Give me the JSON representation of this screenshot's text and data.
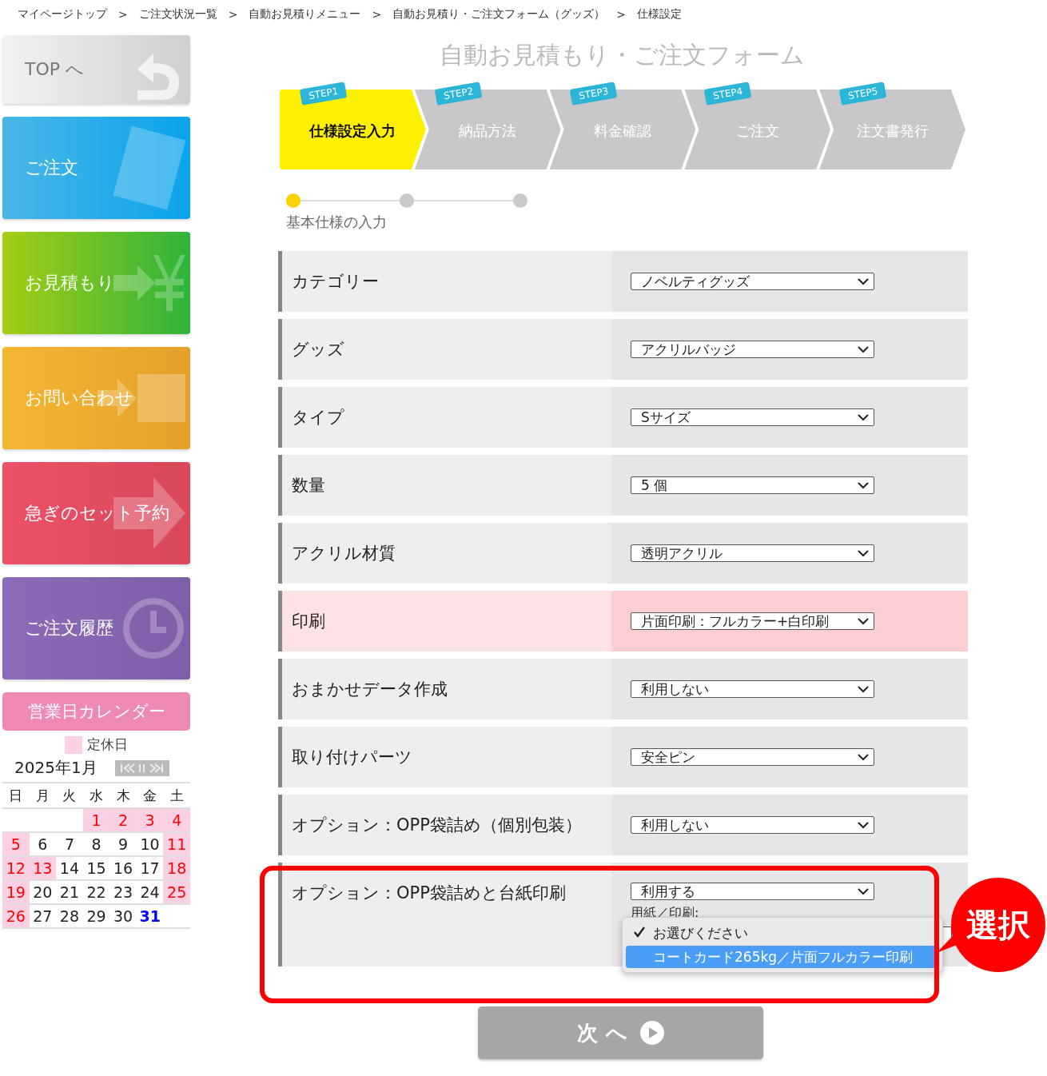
{
  "breadcrumb": [
    "マイページトップ",
    "ご注文状況一覧",
    "自動お見積りメニュー",
    "自動お見積り・ご注文フォーム（グッズ）",
    "仕様設定"
  ],
  "breadcrumb_separator": ">",
  "sidebar": {
    "nav": [
      {
        "label": "TOP へ",
        "kind": "top"
      },
      {
        "label": "ご注文",
        "kind": "order"
      },
      {
        "label": "お見積もり",
        "kind": "estimate"
      },
      {
        "label": "お問い合わせ",
        "kind": "contact"
      },
      {
        "label": "急ぎのセット予約",
        "kind": "rush"
      },
      {
        "label": "ご注文履歴",
        "kind": "history"
      }
    ],
    "calendar": {
      "button": "営業日カレンダー",
      "legend": "定休日",
      "month": "2025年1月",
      "weekdays": [
        "日",
        "月",
        "火",
        "水",
        "木",
        "金",
        "土"
      ],
      "weeks": [
        [
          {
            "kind": "blank"
          },
          {
            "kind": "blank"
          },
          {
            "kind": "blank"
          },
          {
            "day": "1",
            "kind": "holiday"
          },
          {
            "day": "2",
            "kind": "holiday"
          },
          {
            "day": "3",
            "kind": "holiday"
          },
          {
            "day": "4",
            "kind": "holiday"
          }
        ],
        [
          {
            "day": "5",
            "kind": "holiday"
          },
          {
            "day": "6",
            "kind": "normal"
          },
          {
            "day": "7",
            "kind": "normal"
          },
          {
            "day": "8",
            "kind": "normal"
          },
          {
            "day": "9",
            "kind": "normal"
          },
          {
            "day": "10",
            "kind": "normal"
          },
          {
            "day": "11",
            "kind": "holiday"
          }
        ],
        [
          {
            "day": "12",
            "kind": "holiday"
          },
          {
            "day": "13",
            "kind": "holiday"
          },
          {
            "day": "14",
            "kind": "normal"
          },
          {
            "day": "15",
            "kind": "normal"
          },
          {
            "day": "16",
            "kind": "normal"
          },
          {
            "day": "17",
            "kind": "normal"
          },
          {
            "day": "18",
            "kind": "holiday"
          }
        ],
        [
          {
            "day": "19",
            "kind": "holiday"
          },
          {
            "day": "20",
            "kind": "normal"
          },
          {
            "day": "21",
            "kind": "normal"
          },
          {
            "day": "22",
            "kind": "normal"
          },
          {
            "day": "23",
            "kind": "normal"
          },
          {
            "day": "24",
            "kind": "normal"
          },
          {
            "day": "25",
            "kind": "holiday"
          }
        ],
        [
          {
            "day": "26",
            "kind": "holiday"
          },
          {
            "day": "27",
            "kind": "normal"
          },
          {
            "day": "28",
            "kind": "normal"
          },
          {
            "day": "29",
            "kind": "normal"
          },
          {
            "day": "30",
            "kind": "normal"
          },
          {
            "day": "31",
            "kind": "today"
          },
          {
            "kind": "blank"
          }
        ]
      ]
    }
  },
  "title": "自動お見積もり・ご注文フォーム",
  "steps": [
    {
      "badge": "STEP1",
      "label": "仕様設定入力",
      "selected": true
    },
    {
      "badge": "STEP2",
      "label": "納品方法",
      "selected": false
    },
    {
      "badge": "STEP3",
      "label": "料金確認",
      "selected": false
    },
    {
      "badge": "STEP4",
      "label": "ご注文",
      "selected": false
    },
    {
      "badge": "STEP5",
      "label": "注文書発行",
      "selected": false
    }
  ],
  "progress": {
    "dots": [
      {
        "selected": true
      },
      {
        "selected": false
      },
      {
        "selected": false
      }
    ],
    "caption": "基本仕様の入力"
  },
  "form": {
    "rows": [
      {
        "label": "カテゴリー",
        "value": "ノベルティグッズ",
        "highlighted": false
      },
      {
        "label": "グッズ",
        "value": "アクリルバッジ",
        "highlighted": false
      },
      {
        "label": "タイプ",
        "value": "Sサイズ",
        "highlighted": false
      },
      {
        "label": "数量",
        "value": "5 個",
        "highlighted": false
      },
      {
        "label": "アクリル材質",
        "value": "透明アクリル",
        "highlighted": false
      },
      {
        "label": "印刷",
        "value": "片面印刷：フルカラー+白印刷",
        "highlighted": true
      },
      {
        "label": "おまかせデータ作成",
        "value": "利用しない",
        "highlighted": false
      },
      {
        "label": "取り付けパーツ",
        "value": "安全ピン",
        "highlighted": false
      },
      {
        "label": "オプション：OPP袋詰め（個別包装）",
        "value": "利用しない",
        "highlighted": false
      },
      {
        "label": "オプション：OPP袋詰めと台紙印刷",
        "value": "利用する",
        "highlighted": false,
        "sub_label": "用紙／印刷:",
        "dropdown": [
          {
            "label": "お選びください",
            "checked": true,
            "selected": false
          },
          {
            "label": "コートカード265kg／片面フルカラー印刷",
            "checked": false,
            "selected": true
          }
        ]
      }
    ]
  },
  "callout": "選択",
  "next_button": "次 へ"
}
